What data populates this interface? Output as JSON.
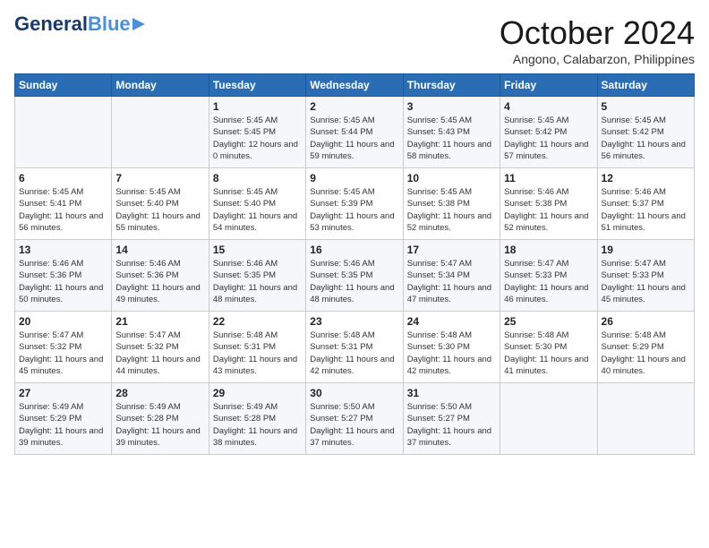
{
  "header": {
    "logo_line1": "General",
    "logo_line2": "Blue",
    "month": "October 2024",
    "location": "Angono, Calabarzon, Philippines"
  },
  "weekdays": [
    "Sunday",
    "Monday",
    "Tuesday",
    "Wednesday",
    "Thursday",
    "Friday",
    "Saturday"
  ],
  "weeks": [
    [
      {
        "day": "",
        "info": ""
      },
      {
        "day": "",
        "info": ""
      },
      {
        "day": "1",
        "info": "Sunrise: 5:45 AM\nSunset: 5:45 PM\nDaylight: 12 hours\nand 0 minutes."
      },
      {
        "day": "2",
        "info": "Sunrise: 5:45 AM\nSunset: 5:44 PM\nDaylight: 11 hours\nand 59 minutes."
      },
      {
        "day": "3",
        "info": "Sunrise: 5:45 AM\nSunset: 5:43 PM\nDaylight: 11 hours\nand 58 minutes."
      },
      {
        "day": "4",
        "info": "Sunrise: 5:45 AM\nSunset: 5:42 PM\nDaylight: 11 hours\nand 57 minutes."
      },
      {
        "day": "5",
        "info": "Sunrise: 5:45 AM\nSunset: 5:42 PM\nDaylight: 11 hours\nand 56 minutes."
      }
    ],
    [
      {
        "day": "6",
        "info": "Sunrise: 5:45 AM\nSunset: 5:41 PM\nDaylight: 11 hours\nand 56 minutes."
      },
      {
        "day": "7",
        "info": "Sunrise: 5:45 AM\nSunset: 5:40 PM\nDaylight: 11 hours\nand 55 minutes."
      },
      {
        "day": "8",
        "info": "Sunrise: 5:45 AM\nSunset: 5:40 PM\nDaylight: 11 hours\nand 54 minutes."
      },
      {
        "day": "9",
        "info": "Sunrise: 5:45 AM\nSunset: 5:39 PM\nDaylight: 11 hours\nand 53 minutes."
      },
      {
        "day": "10",
        "info": "Sunrise: 5:45 AM\nSunset: 5:38 PM\nDaylight: 11 hours\nand 52 minutes."
      },
      {
        "day": "11",
        "info": "Sunrise: 5:46 AM\nSunset: 5:38 PM\nDaylight: 11 hours\nand 52 minutes."
      },
      {
        "day": "12",
        "info": "Sunrise: 5:46 AM\nSunset: 5:37 PM\nDaylight: 11 hours\nand 51 minutes."
      }
    ],
    [
      {
        "day": "13",
        "info": "Sunrise: 5:46 AM\nSunset: 5:36 PM\nDaylight: 11 hours\nand 50 minutes."
      },
      {
        "day": "14",
        "info": "Sunrise: 5:46 AM\nSunset: 5:36 PM\nDaylight: 11 hours\nand 49 minutes."
      },
      {
        "day": "15",
        "info": "Sunrise: 5:46 AM\nSunset: 5:35 PM\nDaylight: 11 hours\nand 48 minutes."
      },
      {
        "day": "16",
        "info": "Sunrise: 5:46 AM\nSunset: 5:35 PM\nDaylight: 11 hours\nand 48 minutes."
      },
      {
        "day": "17",
        "info": "Sunrise: 5:47 AM\nSunset: 5:34 PM\nDaylight: 11 hours\nand 47 minutes."
      },
      {
        "day": "18",
        "info": "Sunrise: 5:47 AM\nSunset: 5:33 PM\nDaylight: 11 hours\nand 46 minutes."
      },
      {
        "day": "19",
        "info": "Sunrise: 5:47 AM\nSunset: 5:33 PM\nDaylight: 11 hours\nand 45 minutes."
      }
    ],
    [
      {
        "day": "20",
        "info": "Sunrise: 5:47 AM\nSunset: 5:32 PM\nDaylight: 11 hours\nand 45 minutes."
      },
      {
        "day": "21",
        "info": "Sunrise: 5:47 AM\nSunset: 5:32 PM\nDaylight: 11 hours\nand 44 minutes."
      },
      {
        "day": "22",
        "info": "Sunrise: 5:48 AM\nSunset: 5:31 PM\nDaylight: 11 hours\nand 43 minutes."
      },
      {
        "day": "23",
        "info": "Sunrise: 5:48 AM\nSunset: 5:31 PM\nDaylight: 11 hours\nand 42 minutes."
      },
      {
        "day": "24",
        "info": "Sunrise: 5:48 AM\nSunset: 5:30 PM\nDaylight: 11 hours\nand 42 minutes."
      },
      {
        "day": "25",
        "info": "Sunrise: 5:48 AM\nSunset: 5:30 PM\nDaylight: 11 hours\nand 41 minutes."
      },
      {
        "day": "26",
        "info": "Sunrise: 5:48 AM\nSunset: 5:29 PM\nDaylight: 11 hours\nand 40 minutes."
      }
    ],
    [
      {
        "day": "27",
        "info": "Sunrise: 5:49 AM\nSunset: 5:29 PM\nDaylight: 11 hours\nand 39 minutes."
      },
      {
        "day": "28",
        "info": "Sunrise: 5:49 AM\nSunset: 5:28 PM\nDaylight: 11 hours\nand 39 minutes."
      },
      {
        "day": "29",
        "info": "Sunrise: 5:49 AM\nSunset: 5:28 PM\nDaylight: 11 hours\nand 38 minutes."
      },
      {
        "day": "30",
        "info": "Sunrise: 5:50 AM\nSunset: 5:27 PM\nDaylight: 11 hours\nand 37 minutes."
      },
      {
        "day": "31",
        "info": "Sunrise: 5:50 AM\nSunset: 5:27 PM\nDaylight: 11 hours\nand 37 minutes."
      },
      {
        "day": "",
        "info": ""
      },
      {
        "day": "",
        "info": ""
      }
    ]
  ]
}
